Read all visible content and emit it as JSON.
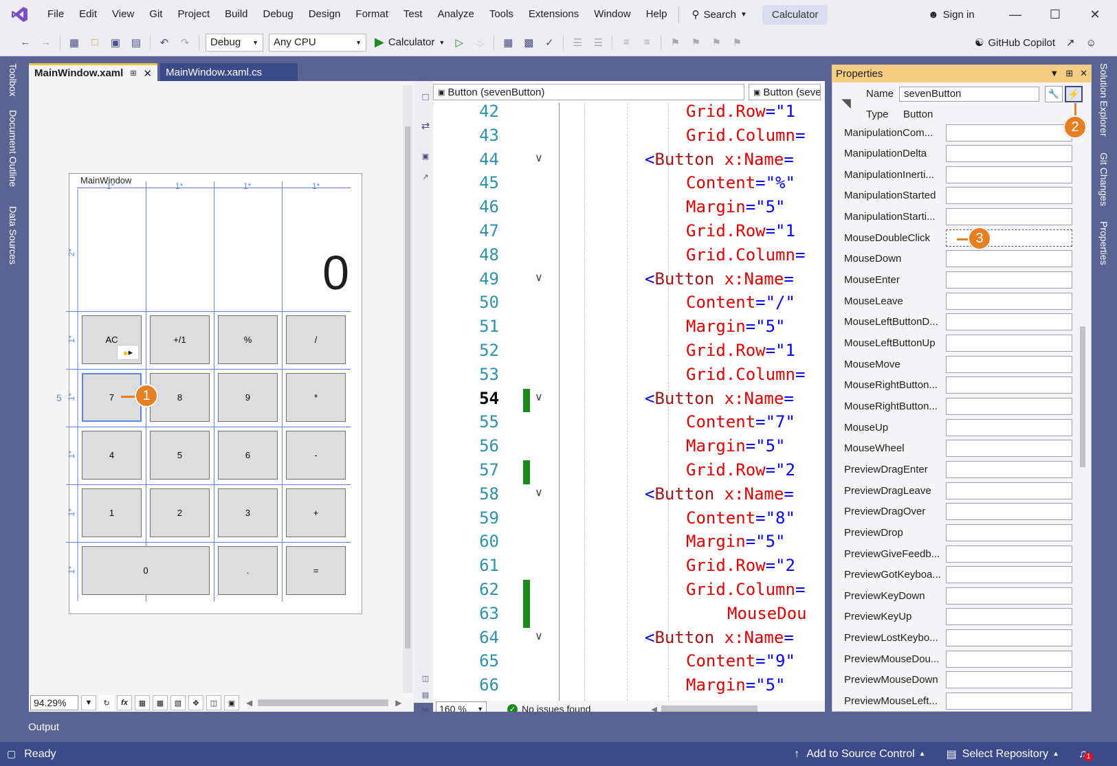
{
  "menu": [
    "File",
    "Edit",
    "View",
    "Git",
    "Project",
    "Build",
    "Debug",
    "Design",
    "Format",
    "Test",
    "Analyze",
    "Tools",
    "Extensions",
    "Window",
    "Help"
  ],
  "search_label": "Search",
  "window_title": "Calculator",
  "signin_label": "Sign in",
  "toolbar": {
    "config": "Debug",
    "platform": "Any CPU",
    "run_target": "Calculator",
    "copilot": "GitHub Copilot"
  },
  "side_tabs_left": [
    "Toolbox",
    "Document Outline",
    "Data Sources"
  ],
  "side_tabs_right": [
    "Solution Explorer",
    "Git Changes",
    "Properties"
  ],
  "doc_tabs": [
    {
      "label": "MainWindow.xaml",
      "active": true
    },
    {
      "label": "MainWindow.xaml.cs",
      "active": false
    }
  ],
  "designer": {
    "window_title": "MainWindow",
    "display_value": "0",
    "col_hints": [
      "1*",
      "1*",
      "1*",
      "1*"
    ],
    "row_hints": [
      "2*",
      "1*",
      "1*",
      "1*",
      "1*",
      "1*"
    ],
    "margin_hint": "5",
    "buttons": [
      [
        "AC",
        "+/1",
        "%",
        "/"
      ],
      [
        "7",
        "8",
        "9",
        "*"
      ],
      [
        "4",
        "5",
        "6",
        "-"
      ],
      [
        "1",
        "2",
        "3",
        "+"
      ],
      [
        "0",
        ".",
        "="
      ]
    ],
    "zoom": "94.29%",
    "fx": "fx"
  },
  "editor": {
    "nav_left": "Button (sevenButton)",
    "nav_right": "Button (seve",
    "zoom": "160 %",
    "status": "No issues found",
    "lines": [
      {
        "n": "42",
        "indent": 2,
        "parts": [
          [
            "attr",
            "Grid.Row"
          ],
          [
            "brk",
            "=\"1"
          ]
        ]
      },
      {
        "n": "43",
        "indent": 2,
        "parts": [
          [
            "attr",
            "Grid.Column"
          ],
          [
            "brk",
            "="
          ]
        ]
      },
      {
        "n": "44",
        "indent": 0,
        "fold": true,
        "parts": [
          [
            "brk",
            "<"
          ],
          [
            "tag",
            "Button"
          ],
          [
            "attr",
            " x:Name"
          ],
          [
            "brk",
            "="
          ]
        ]
      },
      {
        "n": "45",
        "indent": 2,
        "parts": [
          [
            "attr",
            "Content"
          ],
          [
            "brk",
            "=\"%\""
          ]
        ]
      },
      {
        "n": "46",
        "indent": 2,
        "parts": [
          [
            "attr",
            "Margin"
          ],
          [
            "brk",
            "=\"5\""
          ]
        ]
      },
      {
        "n": "47",
        "indent": 2,
        "parts": [
          [
            "attr",
            "Grid.Row"
          ],
          [
            "brk",
            "=\"1"
          ]
        ]
      },
      {
        "n": "48",
        "indent": 2,
        "parts": [
          [
            "attr",
            "Grid.Column"
          ],
          [
            "brk",
            "="
          ]
        ]
      },
      {
        "n": "49",
        "indent": 0,
        "fold": true,
        "parts": [
          [
            "brk",
            "<"
          ],
          [
            "tag",
            "Button"
          ],
          [
            "attr",
            " x:Name"
          ],
          [
            "brk",
            "="
          ]
        ]
      },
      {
        "n": "50",
        "indent": 2,
        "parts": [
          [
            "attr",
            "Content"
          ],
          [
            "brk",
            "=\"/\""
          ]
        ]
      },
      {
        "n": "51",
        "indent": 2,
        "parts": [
          [
            "attr",
            "Margin"
          ],
          [
            "brk",
            "=\"5\""
          ]
        ]
      },
      {
        "n": "52",
        "indent": 2,
        "parts": [
          [
            "attr",
            "Grid.Row"
          ],
          [
            "brk",
            "=\"1"
          ]
        ]
      },
      {
        "n": "53",
        "indent": 2,
        "parts": [
          [
            "attr",
            "Grid.Column"
          ],
          [
            "brk",
            "="
          ]
        ]
      },
      {
        "n": "54",
        "indent": 0,
        "fold": true,
        "cur": true,
        "chg": true,
        "parts": [
          [
            "brk",
            "<"
          ],
          [
            "tag",
            "Button"
          ],
          [
            "attr",
            " x:Name"
          ],
          [
            "brk",
            "="
          ]
        ]
      },
      {
        "n": "55",
        "indent": 2,
        "parts": [
          [
            "attr",
            "Content"
          ],
          [
            "brk",
            "=\"7\""
          ]
        ]
      },
      {
        "n": "56",
        "indent": 2,
        "parts": [
          [
            "attr",
            "Margin"
          ],
          [
            "brk",
            "=\"5\""
          ]
        ]
      },
      {
        "n": "57",
        "indent": 2,
        "chg": true,
        "parts": [
          [
            "attr",
            "Grid.Row"
          ],
          [
            "brk",
            "=\"2"
          ]
        ]
      },
      {
        "n": "58",
        "indent": 0,
        "fold": true,
        "parts": [
          [
            "brk",
            "<"
          ],
          [
            "tag",
            "Button"
          ],
          [
            "attr",
            " x:Name"
          ],
          [
            "brk",
            "="
          ]
        ]
      },
      {
        "n": "59",
        "indent": 2,
        "parts": [
          [
            "attr",
            "Content"
          ],
          [
            "brk",
            "=\"8\""
          ]
        ]
      },
      {
        "n": "60",
        "indent": 2,
        "parts": [
          [
            "attr",
            "Margin"
          ],
          [
            "brk",
            "=\"5\""
          ]
        ]
      },
      {
        "n": "61",
        "indent": 2,
        "parts": [
          [
            "attr",
            "Grid.Row"
          ],
          [
            "brk",
            "=\"2"
          ]
        ]
      },
      {
        "n": "62",
        "indent": 2,
        "chg": true,
        "parts": [
          [
            "attr",
            "Grid.Column"
          ],
          [
            "brk",
            "="
          ]
        ]
      },
      {
        "n": "63",
        "indent": 4,
        "chg": true,
        "parts": [
          [
            "attr",
            "MouseDou"
          ]
        ]
      },
      {
        "n": "64",
        "indent": 0,
        "fold": true,
        "parts": [
          [
            "brk",
            "<"
          ],
          [
            "tag",
            "Button"
          ],
          [
            "attr",
            " x:Name"
          ],
          [
            "brk",
            "="
          ]
        ]
      },
      {
        "n": "65",
        "indent": 2,
        "parts": [
          [
            "attr",
            "Content"
          ],
          [
            "brk",
            "=\"9\""
          ]
        ]
      },
      {
        "n": "66",
        "indent": 2,
        "parts": [
          [
            "attr",
            "Margin"
          ],
          [
            "brk",
            "=\"5\""
          ]
        ]
      }
    ]
  },
  "properties": {
    "title": "Properties",
    "name_label": "Name",
    "name_value": "sevenButton",
    "type_label": "Type",
    "type_value": "Button",
    "events": [
      "ManipulationCom...",
      "ManipulationDelta",
      "ManipulationInerti...",
      "ManipulationStarted",
      "ManipulationStarti...",
      "MouseDoubleClick",
      "MouseDown",
      "MouseEnter",
      "MouseLeave",
      "MouseLeftButtonD...",
      "MouseLeftButtonUp",
      "MouseMove",
      "MouseRightButton...",
      "MouseRightButton...",
      "MouseUp",
      "MouseWheel",
      "PreviewDragEnter",
      "PreviewDragLeave",
      "PreviewDragOver",
      "PreviewDrop",
      "PreviewGiveFeedb...",
      "PreviewGotKeyboa...",
      "PreviewKeyDown",
      "PreviewKeyUp",
      "PreviewLostKeybo...",
      "PreviewMouseDou...",
      "PreviewMouseDown",
      "PreviewMouseLeft..."
    ]
  },
  "callouts": [
    "1",
    "2",
    "3"
  ],
  "output_label": "Output",
  "status": {
    "ready": "Ready",
    "source_control": "Add to Source Control",
    "repo": "Select Repository",
    "notifications": "1"
  },
  "colors": {
    "frame": "#5a6494",
    "accent_orange": "#e67e22",
    "props_title": "#f5cc84",
    "status_bar": "#3c4a8a",
    "change_green": "#1a8a1a"
  }
}
